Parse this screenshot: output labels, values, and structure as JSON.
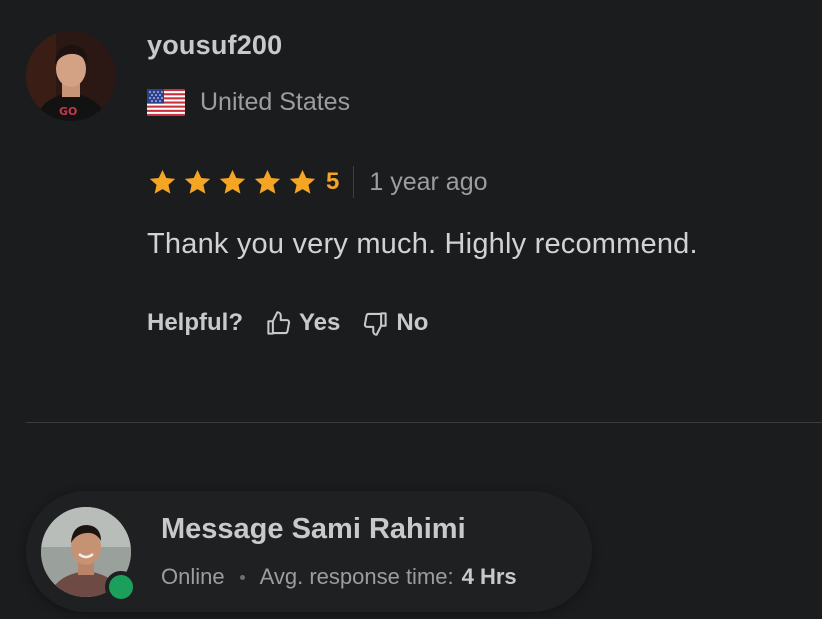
{
  "review": {
    "reviewer_name": "yousuf200",
    "country": "United States",
    "flag_icon": "us-flag-icon",
    "rating": 5,
    "rating_label": "5",
    "time_ago": "1 year ago",
    "text": "Thank you very much. Highly recommend.",
    "helpful_label": "Helpful?",
    "yes_label": "Yes",
    "no_label": "No",
    "star_color": "#f5a524"
  },
  "contact": {
    "title": "Message Sami Rahimi",
    "status": "Online",
    "response_label": "Avg. response time:",
    "response_value": "4 Hrs",
    "status_color": "#1aa05a"
  }
}
